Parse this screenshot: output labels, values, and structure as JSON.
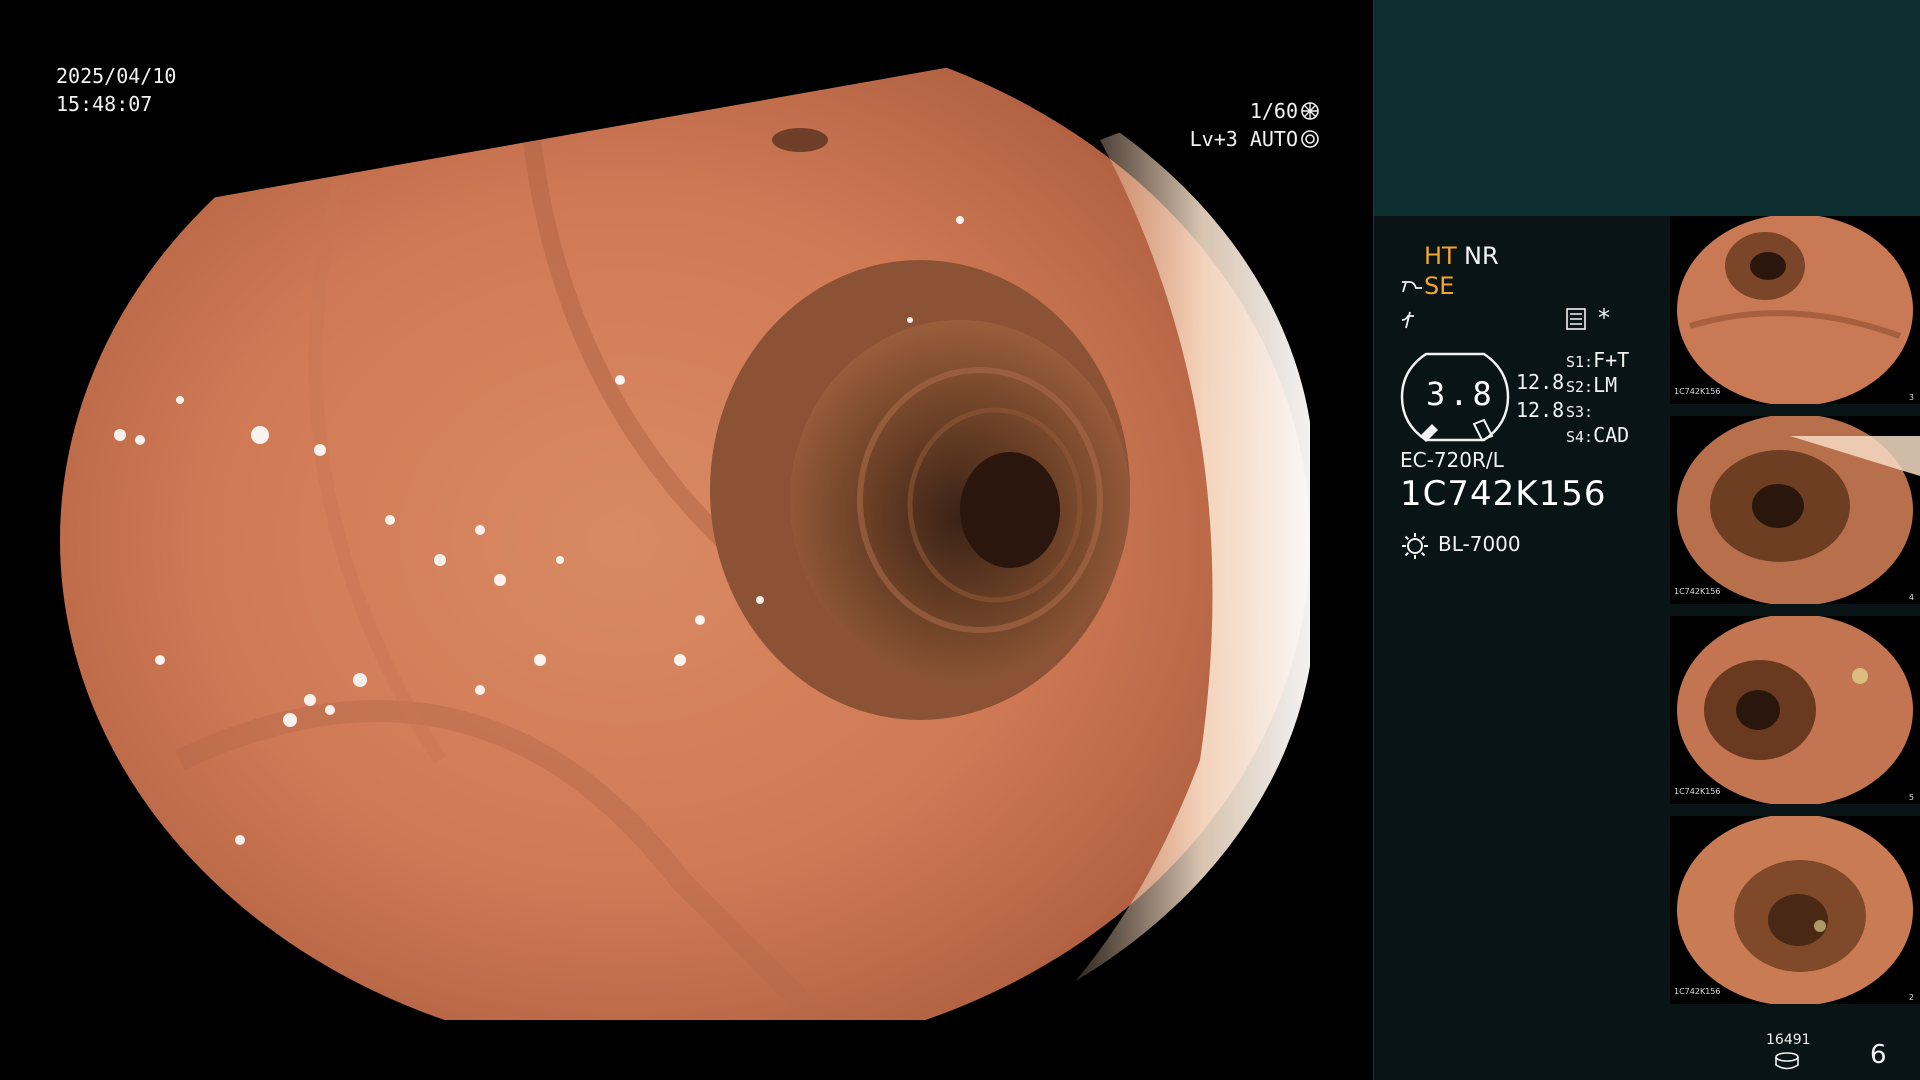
{
  "osd": {
    "date": "2025/04/10",
    "time": "15:48:07",
    "shutter": "1/60",
    "level_mode": "Lv+3 AUTO"
  },
  "panel": {
    "ht": "HT",
    "nr": "NR",
    "se": "SE",
    "asterisk": "*",
    "gauge_value": "3.8",
    "value_1": "12.8",
    "value_2": "12.8",
    "slots": [
      {
        "key": "S1:",
        "value": "F+T"
      },
      {
        "key": "S2:",
        "value": "LM"
      },
      {
        "key": "S3:",
        "value": ""
      },
      {
        "key": "S4:",
        "value": "CAD"
      }
    ],
    "scope_model": "EC-720R/L",
    "serial": "1C742K156",
    "light_source": "BL-7000",
    "storage_count": "16491",
    "capture_count": "6",
    "accent_color": "#f5a623",
    "panel_color": "#0d2e30"
  },
  "thumbnails": [
    {
      "id": "1C742K156",
      "num": "3"
    },
    {
      "id": "1C742K156",
      "num": "4"
    },
    {
      "id": "1C742K156",
      "num": "5"
    },
    {
      "id": "1C742K156",
      "num": "2"
    }
  ]
}
